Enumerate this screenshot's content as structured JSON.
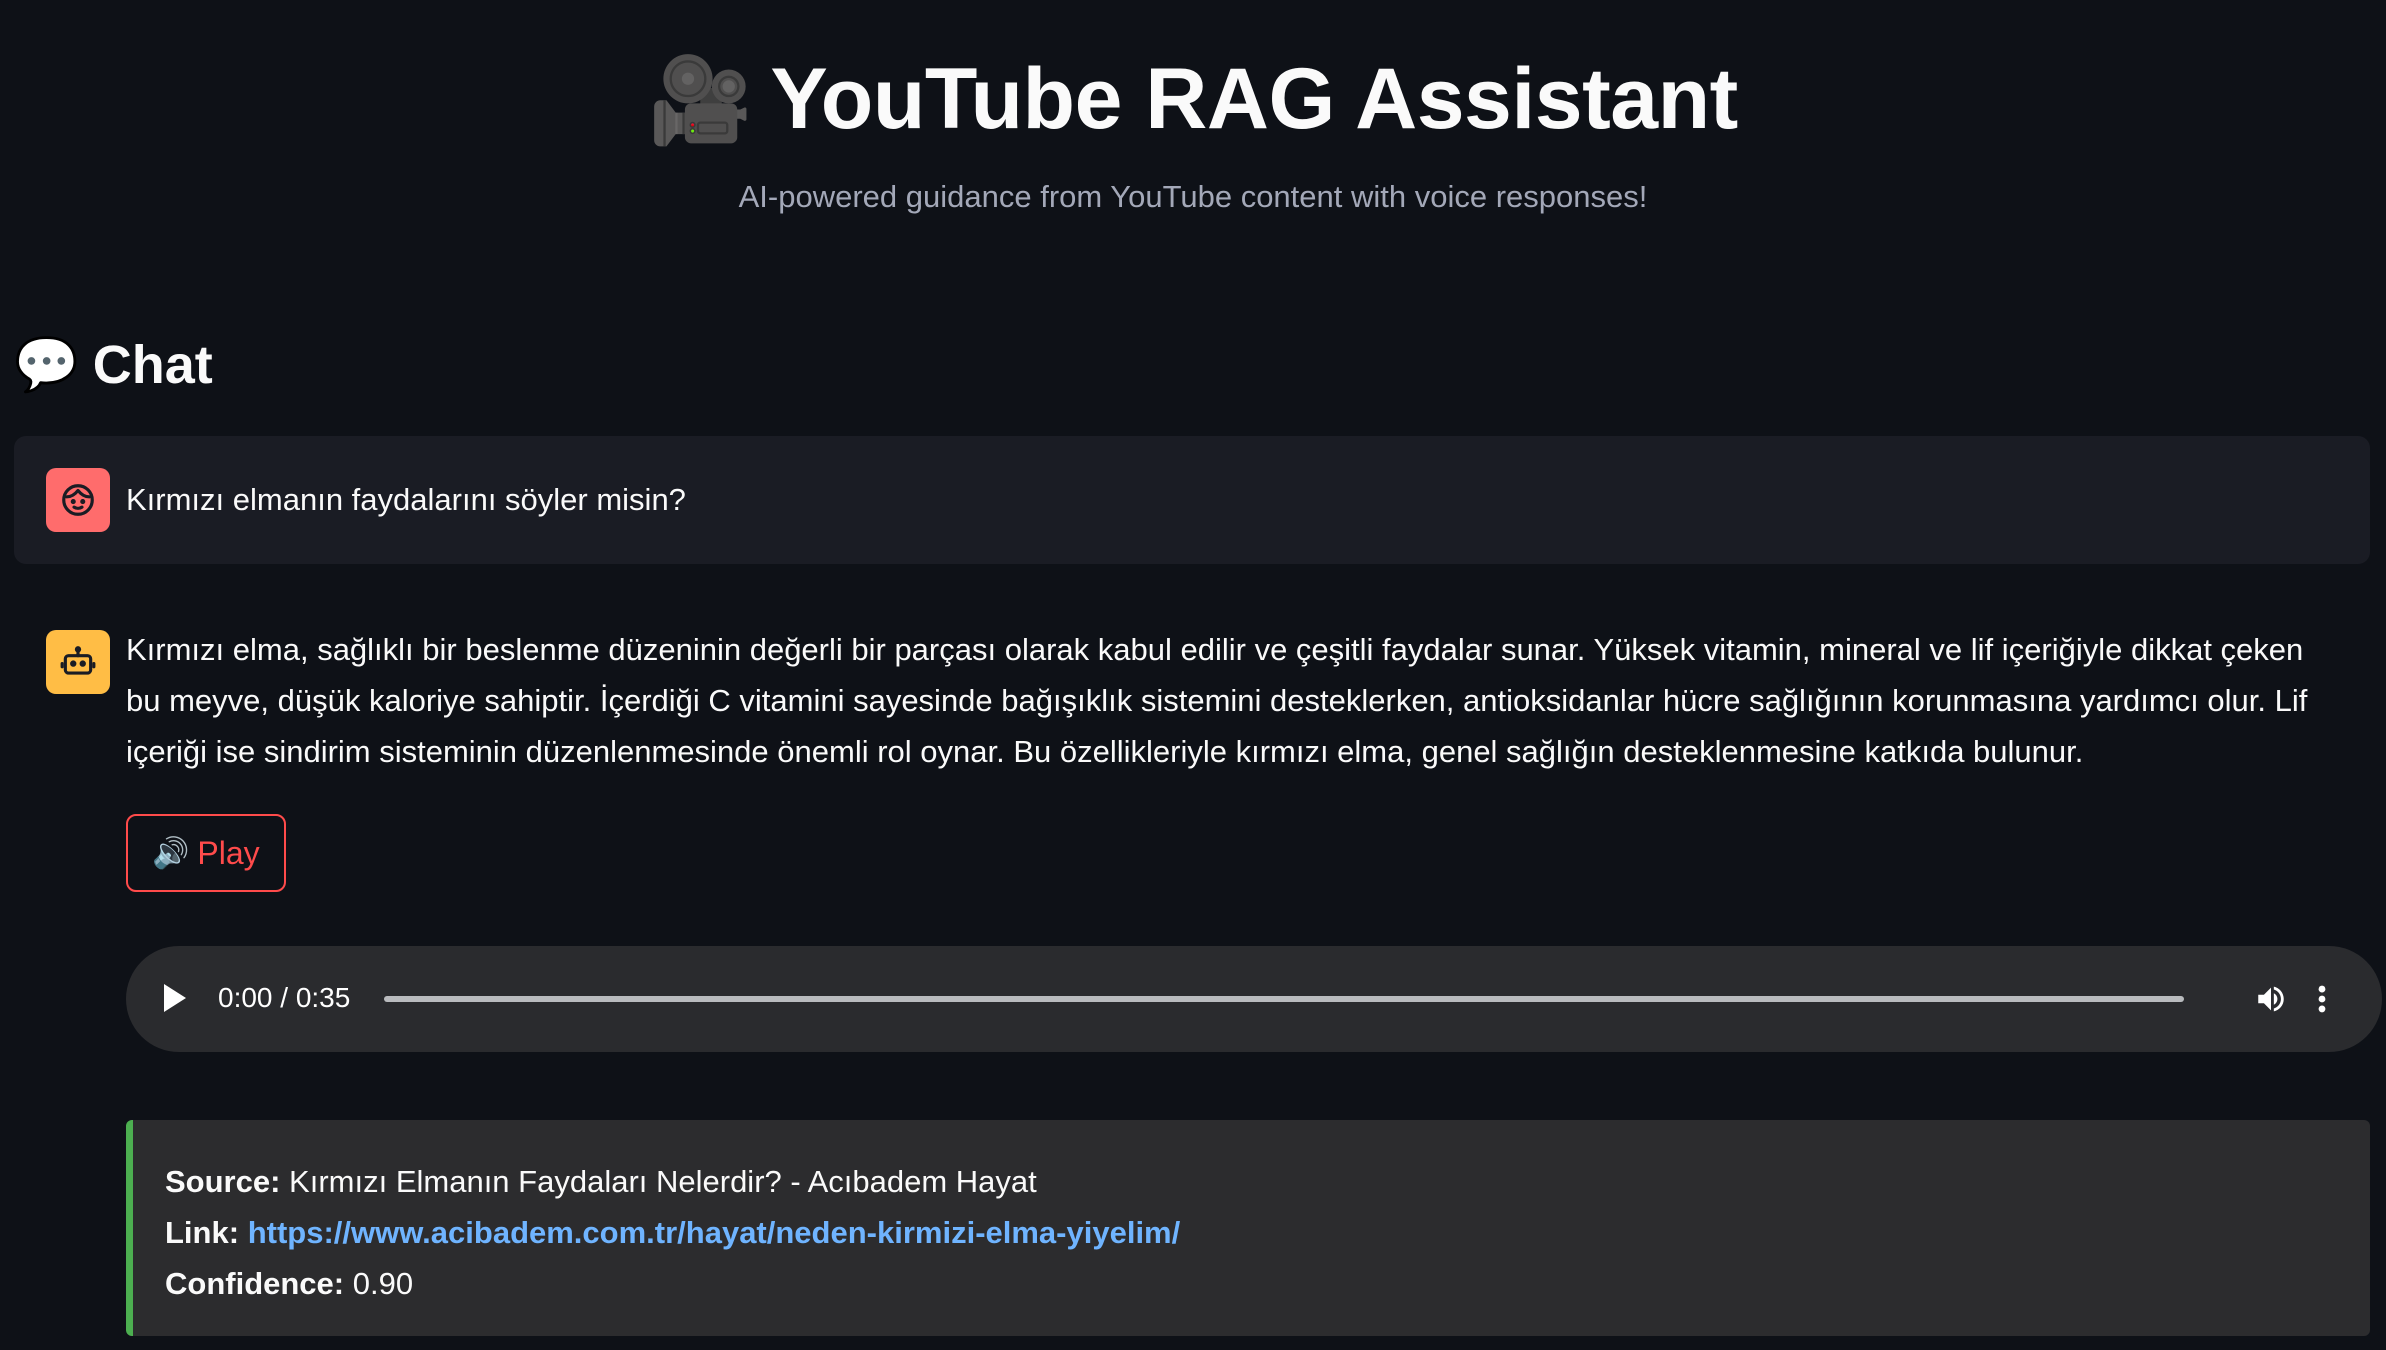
{
  "header": {
    "title_icon": "movie-camera-icon",
    "title": "YouTube RAG Assistant",
    "subtitle": "AI-powered guidance from YouTube content with voice responses!"
  },
  "chat": {
    "section_icon": "speech-bubble-icon",
    "section_title": "Chat",
    "messages": [
      {
        "role": "user",
        "avatar": "user-face-icon",
        "text": "Kırmızı elmanın faydalarını söyler misin?"
      },
      {
        "role": "assistant",
        "avatar": "robot-icon",
        "text": "Kırmızı elma, sağlıklı bir beslenme düzeninin değerli bir parçası olarak kabul edilir ve çeşitli faydalar sunar. Yüksek vitamin, mineral ve lif içeriğiyle dikkat çeken bu meyve, düşük kaloriye sahiptir. İçerdiği C vitamini sayesinde bağışıklık sistemini desteklerken, antioksidanlar hücre sağlığının korunmasına yardımcı olur. Lif içeriği ise sindirim sisteminin düzenlenmesinde önemli rol oynar. Bu özellikleriyle kırmızı elma, genel sağlığın desteklenmesine katkıda bulunur.",
        "play_button": {
          "icon": "speaker-icon",
          "label": "Play"
        },
        "audio": {
          "time": "0:00 / 0:35",
          "progress": 0.0
        },
        "source": {
          "source_label": "Source:",
          "source_value": "Kırmızı Elmanın Faydaları Nelerdir? - Acıbadem Hayat",
          "link_label": "Link:",
          "link_value": "https://www.acibadem.com.tr/hayat/neden-kirmizi-elma-yiyelim/",
          "confidence_label": "Confidence:",
          "confidence_value": "0.90"
        }
      }
    ]
  },
  "colors": {
    "background": "#0e1117",
    "user_avatar": "#ff6c6c",
    "assistant_avatar": "#ffbd45",
    "play_accent": "#ff4b4b",
    "source_accent": "#4caf50",
    "link": "#6fb4ff"
  }
}
